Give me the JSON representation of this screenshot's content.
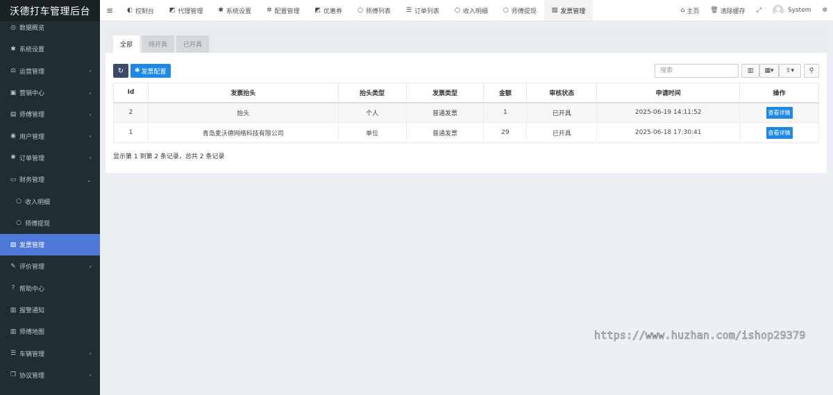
{
  "sidebar": {
    "logo": "沃德打车管理后台",
    "items": [
      {
        "label": "数据概览",
        "icon": "dashboard-icon",
        "glyph": "◎",
        "caret": ""
      },
      {
        "label": "系统设置",
        "icon": "gear-icon",
        "glyph": "✱",
        "caret": ""
      },
      {
        "label": "运营管理",
        "icon": "balance-icon",
        "glyph": "⚖",
        "caret": "‹"
      },
      {
        "label": "营销中心",
        "icon": "calendar-icon",
        "glyph": "▣",
        "caret": "‹"
      },
      {
        "label": "师傅管理",
        "icon": "id-card-icon",
        "glyph": "▤",
        "caret": "‹"
      },
      {
        "label": "用户管理",
        "icon": "user-circle-icon",
        "glyph": "◉",
        "caret": "‹"
      },
      {
        "label": "订单管理",
        "icon": "cog-icon",
        "glyph": "✺",
        "caret": "‹"
      },
      {
        "label": "财务管理",
        "icon": "money-icon",
        "glyph": "▭",
        "caret": "⌄"
      },
      {
        "label": "收入明细",
        "icon": "circle-icon",
        "glyph": "○",
        "caret": "",
        "sub": true
      },
      {
        "label": "师傅提现",
        "icon": "circle-icon",
        "glyph": "○",
        "caret": "",
        "sub": true
      },
      {
        "label": "发票管理",
        "icon": "invoice-icon",
        "glyph": "▧",
        "caret": "",
        "active": true
      },
      {
        "label": "评价管理",
        "icon": "edit-icon",
        "glyph": "✎",
        "caret": "‹"
      },
      {
        "label": "帮助中心",
        "icon": "question-icon",
        "glyph": "?",
        "caret": ""
      },
      {
        "label": "报警通知",
        "icon": "map-icon",
        "glyph": "▥",
        "caret": ""
      },
      {
        "label": "师傅地图",
        "icon": "map-icon",
        "glyph": "▥",
        "caret": ""
      },
      {
        "label": "车辆管理",
        "icon": "list-icon",
        "glyph": "☰",
        "caret": "‹"
      },
      {
        "label": "协议管理",
        "icon": "copy-icon",
        "glyph": "❐",
        "caret": "‹"
      }
    ]
  },
  "topnav": {
    "menu_glyph": "≡",
    "tabs": [
      {
        "label": "控制台",
        "icon": "dashboard-icon",
        "glyph": "◐"
      },
      {
        "label": "代理管理",
        "icon": "grid-icon",
        "glyph": "◩"
      },
      {
        "label": "系统设置",
        "icon": "gear-icon",
        "glyph": "✱"
      },
      {
        "label": "配置管理",
        "icon": "cogs-icon",
        "glyph": "✲"
      },
      {
        "label": "优惠券",
        "icon": "grid-icon",
        "glyph": "◩"
      },
      {
        "label": "师傅列表",
        "icon": "circle-icon",
        "glyph": "○"
      },
      {
        "label": "订单列表",
        "icon": "list-icon",
        "glyph": "☰"
      },
      {
        "label": "收入明细",
        "icon": "circle-icon",
        "glyph": "○"
      },
      {
        "label": "师傅提现",
        "icon": "circle-icon",
        "glyph": "○"
      },
      {
        "label": "发票管理",
        "icon": "invoice-icon",
        "glyph": "▧",
        "active": true
      }
    ],
    "right": {
      "home_label": "主页",
      "home_glyph": "⌂",
      "clear_cache_label": "清除缓存",
      "clear_cache_glyph": "🗑",
      "fullscreen_glyph": "⤢",
      "user_label": "System",
      "settings_glyph": "✲"
    }
  },
  "content": {
    "subtabs": [
      {
        "label": "全部",
        "active": true
      },
      {
        "label": "待开具"
      },
      {
        "label": "已开具"
      }
    ],
    "toolbar": {
      "refresh_glyph": "↻",
      "config_label": "发票配置",
      "config_glyph": "✱",
      "search_placeholder": "搜索",
      "columns_glyph": "▥",
      "grid_glyph": "▦▾",
      "export_glyph": "⇪▾",
      "search_glyph": "⚲"
    },
    "table": {
      "headers": [
        "Id",
        "发票抬头",
        "抬头类型",
        "发票类型",
        "金额",
        "审核状态",
        "申请时间",
        "操作"
      ],
      "rows": [
        {
          "id": "2",
          "title": "抬头",
          "title_type": "个人",
          "invoice_type": "普通发票",
          "amount": "1",
          "status": "已开具",
          "time": "2025-06-19 14:11:52",
          "action": "查看详情"
        },
        {
          "id": "1",
          "title": "青岛麦沃德网络科技有限公司",
          "title_type": "单位",
          "invoice_type": "普通发票",
          "amount": "29",
          "status": "已开具",
          "time": "2025-06-18 17:30:41",
          "action": "查看详情"
        }
      ]
    },
    "pager_text": "显示第 1 到第 2 条记录，总共 2 条记录"
  },
  "watermark": "https://www.huzhan.com/ishop29379"
}
